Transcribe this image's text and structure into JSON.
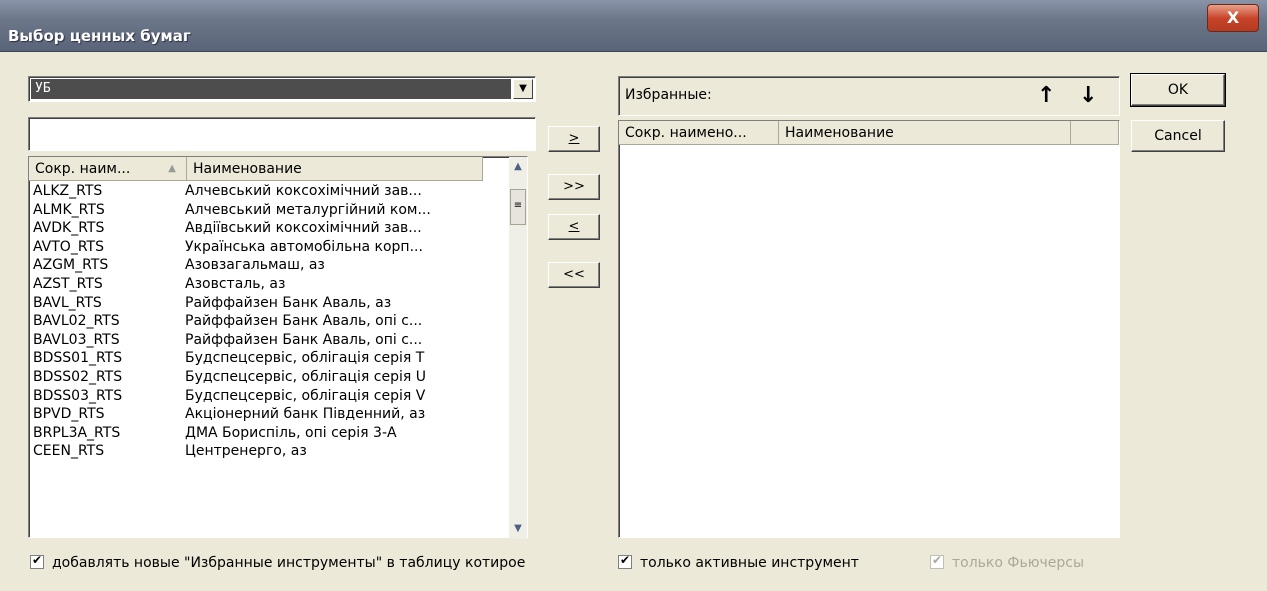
{
  "window": {
    "title": "Выбор ценных бумаг",
    "close_label": "X"
  },
  "group_select": {
    "value": "УБ"
  },
  "filter_input": {
    "value": ""
  },
  "move": {
    "add_one": ">",
    "add_all": ">>",
    "remove_one": "<",
    "remove_all": "<<"
  },
  "left_list": {
    "columns": [
      "Сокр. наим...",
      "Наименование"
    ],
    "rows": [
      [
        "ALKZ_RTS",
        "Алчевський коксохімічний зав..."
      ],
      [
        "ALMK_RTS",
        "Алчевський металургійний ком..."
      ],
      [
        "AVDK_RTS",
        "Авдіївський коксохімічний зав..."
      ],
      [
        "AVTO_RTS",
        "Українська автомобільна корп..."
      ],
      [
        "AZGM_RTS",
        "Азовзагальмаш, аз"
      ],
      [
        "AZST_RTS",
        "Азовсталь, аз"
      ],
      [
        "BAVL_RTS",
        "Райффайзен Банк Аваль, аз"
      ],
      [
        "BAVL02_RTS",
        "Райффайзен Банк Аваль, опі с..."
      ],
      [
        "BAVL03_RTS",
        "Райффайзен Банк Аваль, опі с..."
      ],
      [
        "BDSS01_RTS",
        "Будспецсервіс, облігація серія T"
      ],
      [
        "BDSS02_RTS",
        "Будспецсервіс, облігація серія U"
      ],
      [
        "BDSS03_RTS",
        "Будспецсервіс, облігація серія V"
      ],
      [
        "BPVD_RTS",
        "Акціонерний банк Південний, аз"
      ],
      [
        "BRPL3A_RTS",
        "ДМА Бориспіль, опі серія 3-А"
      ],
      [
        "CEEN_RTS",
        "Центренерго, аз"
      ]
    ]
  },
  "favorites": {
    "label": "Избранные:",
    "columns": [
      "Сокр. наимено...",
      "Наименование"
    ]
  },
  "buttons": {
    "ok": "OK",
    "cancel": "Cancel"
  },
  "checkboxes": {
    "add_new": "добавлять новые \"Избранные инструменты\" в таблицу котирое",
    "only_active": "только активные инструмент",
    "only_futures": "только Фьючерсы"
  }
}
